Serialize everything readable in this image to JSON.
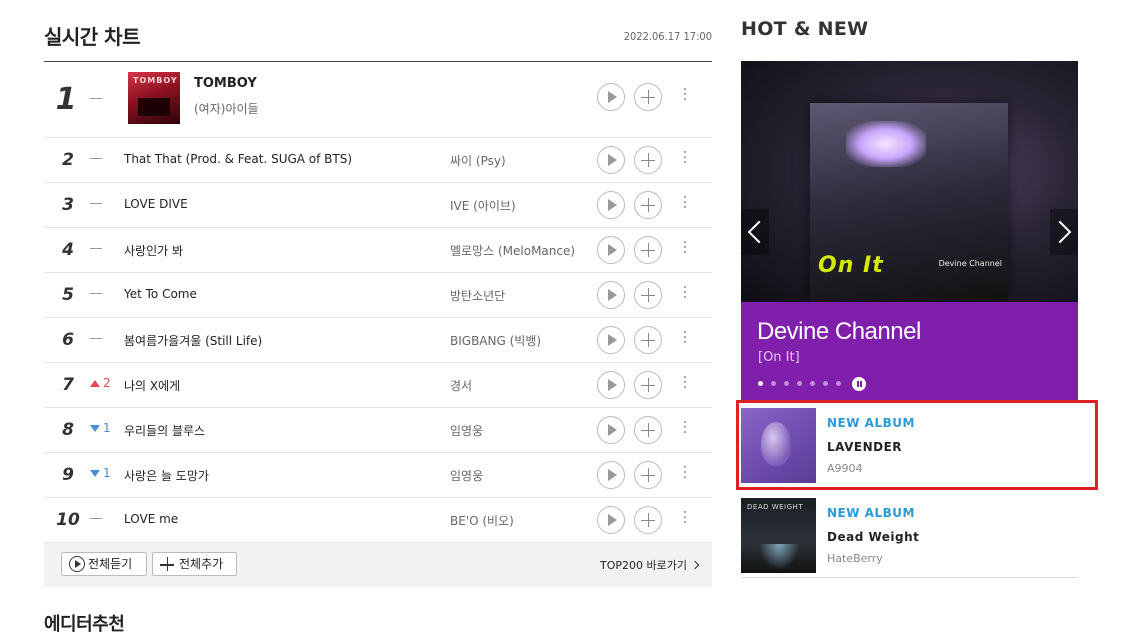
{
  "chart": {
    "title": "실시간 차트",
    "timestamp": "2022.06.17  17:00",
    "rows": [
      {
        "rank": "1",
        "change": "",
        "title": "TOMBOY",
        "artist": "(여자)아이들",
        "change_dir": "same"
      },
      {
        "rank": "2",
        "change": "",
        "title": "That That (Prod. & Feat. SUGA of BTS)",
        "artist": "싸이 (Psy)",
        "change_dir": "same"
      },
      {
        "rank": "3",
        "change": "",
        "title": "LOVE DIVE",
        "artist": "IVE (아이브)",
        "change_dir": "same"
      },
      {
        "rank": "4",
        "change": "",
        "title": "사랑인가 봐",
        "artist": "멜로망스 (MeloMance)",
        "change_dir": "same"
      },
      {
        "rank": "5",
        "change": "",
        "title": "Yet To Come",
        "artist": "방탄소년단",
        "change_dir": "same"
      },
      {
        "rank": "6",
        "change": "",
        "title": "봄여름가을겨울 (Still Life)",
        "artist": "BIGBANG (빅뱅)",
        "change_dir": "same"
      },
      {
        "rank": "7",
        "change": "2",
        "title": "나의 X에게",
        "artist": "경서",
        "change_dir": "up"
      },
      {
        "rank": "8",
        "change": "1",
        "title": "우리들의 블루스",
        "artist": "임영웅",
        "change_dir": "down"
      },
      {
        "rank": "9",
        "change": "1",
        "title": "사랑은 늘 도망가",
        "artist": "임영웅",
        "change_dir": "down"
      },
      {
        "rank": "10",
        "change": "",
        "title": "LOVE me",
        "artist": "BE'O (비오)",
        "change_dir": "same"
      }
    ],
    "cover_text": "TOMBOY",
    "footer": {
      "play_all": "전체듣기",
      "add_all": "전체추가",
      "top200": "TOP200 바로가기"
    }
  },
  "editor": {
    "title": "에디터추천"
  },
  "hotnew": {
    "title": "HOT & NEW",
    "slide": {
      "artist": "Devine Channel",
      "song": "[On It]",
      "cover_text": "On It",
      "cover_caption": "Devine Channel",
      "dot_count": 7,
      "active_dot": 0
    },
    "albums": [
      {
        "tag": "NEW ALBUM",
        "name": "LAVENDER",
        "artist": "A9904"
      },
      {
        "tag": "NEW ALBUM",
        "name": "Dead Weight",
        "artist": "HateBerry",
        "cover_text": "DEAD WEIGHT"
      }
    ]
  },
  "colors": {
    "accent_purple": "#7f1fab",
    "tag_blue": "#2a9bd8",
    "rank_up": "#e4474c",
    "rank_down": "#4a8fd6",
    "highlight_red": "#e01f27"
  }
}
